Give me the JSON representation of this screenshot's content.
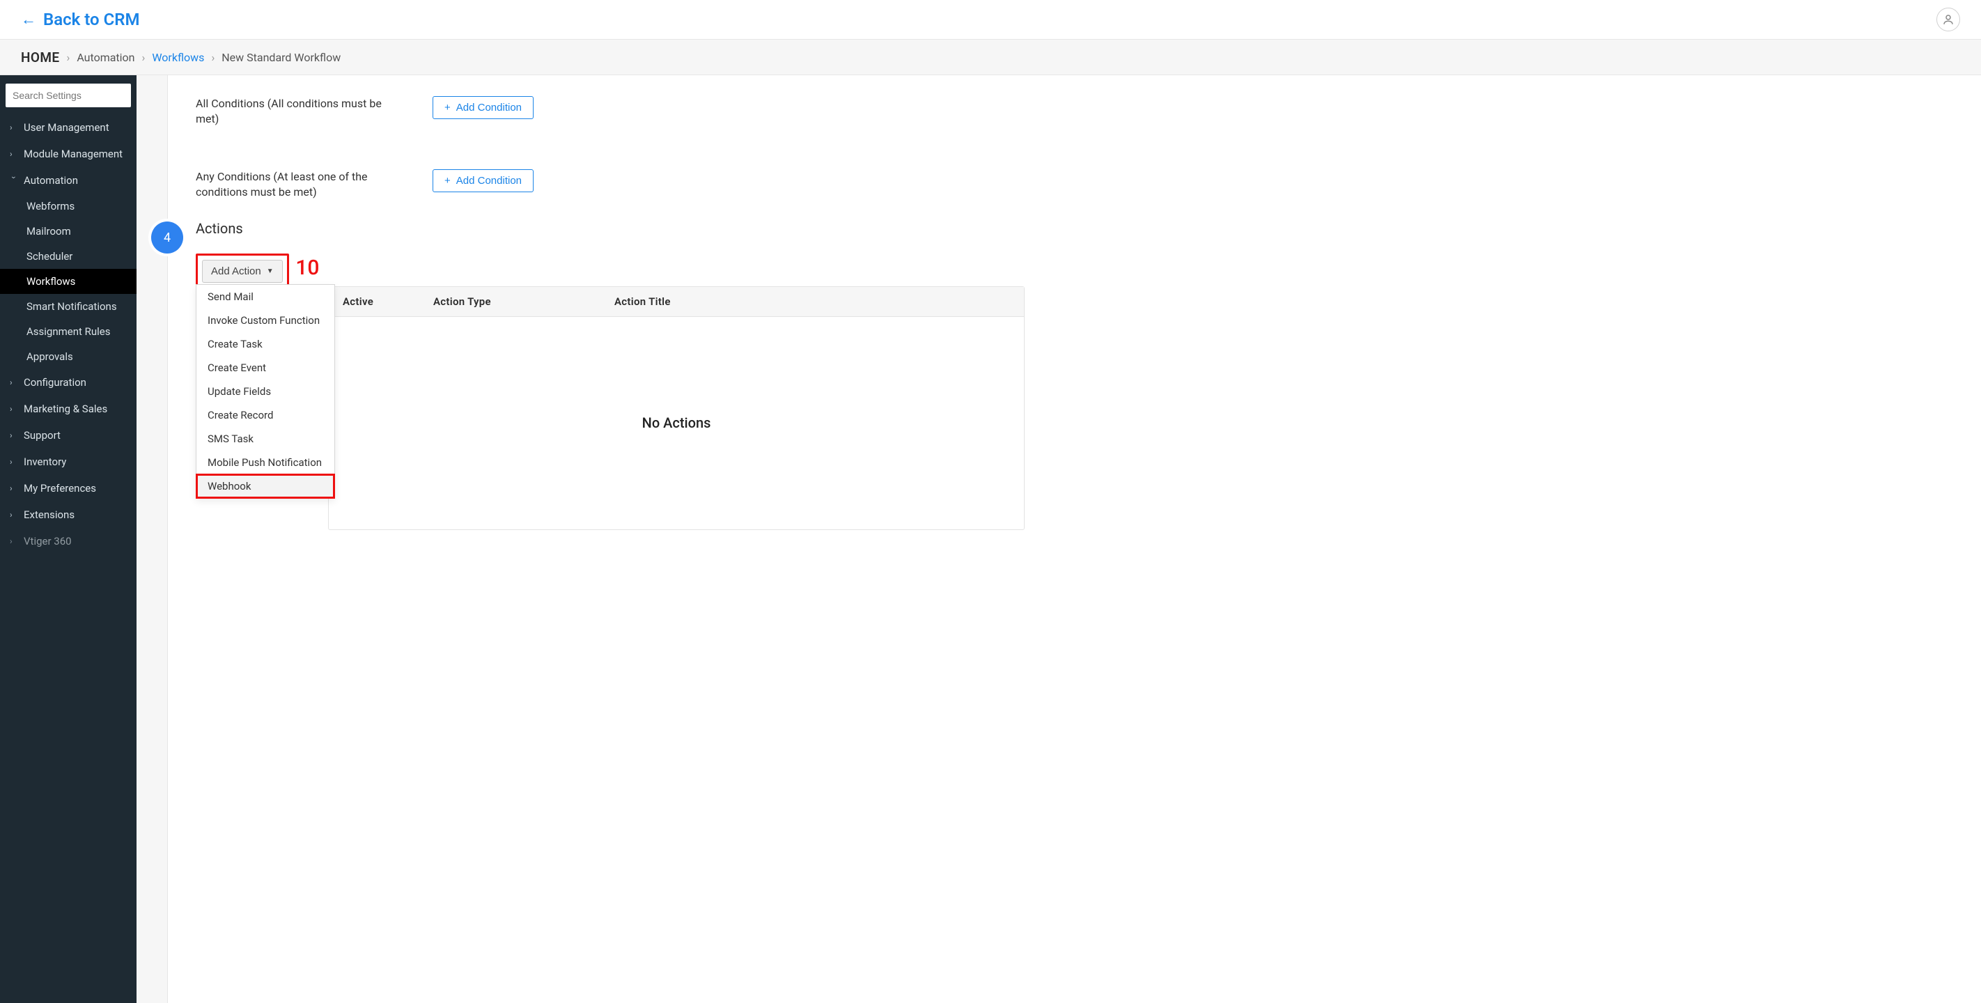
{
  "topbar": {
    "back_label": "Back to CRM"
  },
  "breadcrumb": {
    "home": "HOME",
    "level1": "Automation",
    "level2": "Workflows",
    "current": "New Standard Workflow"
  },
  "search": {
    "placeholder": "Search Settings"
  },
  "sidebar": {
    "items": [
      {
        "label": "User Management",
        "expandable": true
      },
      {
        "label": "Module Management",
        "expandable": true
      },
      {
        "label": "Automation",
        "expandable": true,
        "expanded": true
      },
      {
        "label": "Configuration",
        "expandable": true
      },
      {
        "label": "Marketing & Sales",
        "expandable": true
      },
      {
        "label": "Support",
        "expandable": true
      },
      {
        "label": "Inventory",
        "expandable": true
      },
      {
        "label": "My Preferences",
        "expandable": true
      },
      {
        "label": "Extensions",
        "expandable": true
      },
      {
        "label": "Vtiger 360",
        "expandable": true
      }
    ],
    "automation_children": [
      {
        "label": "Webforms"
      },
      {
        "label": "Mailroom"
      },
      {
        "label": "Scheduler"
      },
      {
        "label": "Workflows",
        "active": true
      },
      {
        "label": "Smart Notifications"
      },
      {
        "label": "Assignment Rules"
      },
      {
        "label": "Approvals"
      }
    ]
  },
  "conditions": {
    "all_label": "All Conditions (All conditions must be met)",
    "any_label": "Any Conditions (At least one of the conditions must be met)",
    "add_button": "Add Condition"
  },
  "step": {
    "number": "4",
    "title": "Actions"
  },
  "add_action": {
    "label": "Add Action",
    "annotation": "10",
    "options": [
      "Send Mail",
      "Invoke Custom Function",
      "Create Task",
      "Create Event",
      "Update Fields",
      "Create Record",
      "SMS Task",
      "Mobile Push Notification",
      "Webhook"
    ],
    "highlighted_option_index": 8
  },
  "actions_table": {
    "headers": {
      "active": "Active",
      "type": "Action Type",
      "title": "Action Title"
    },
    "empty_text": "No Actions"
  }
}
